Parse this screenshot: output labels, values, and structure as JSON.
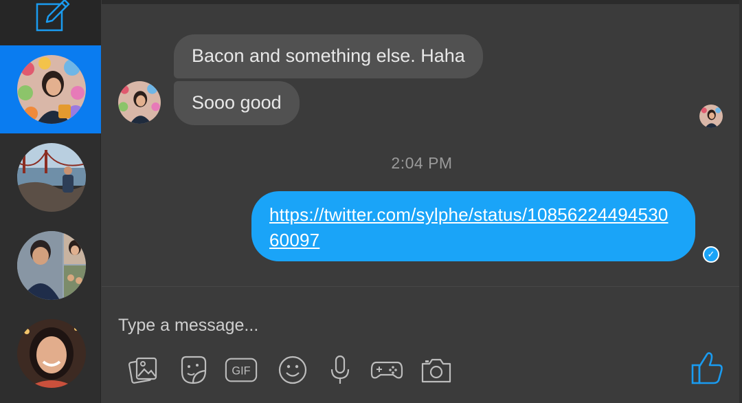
{
  "sidebar": {
    "compose_icon": "compose-icon",
    "conversations": [
      {
        "id": "conv-1",
        "active": true,
        "avatar": "avatar-woman-colorful-wall"
      },
      {
        "id": "conv-2",
        "active": false,
        "avatar": "avatar-golden-gate"
      },
      {
        "id": "conv-3",
        "active": false,
        "avatar": "avatar-group-collage"
      },
      {
        "id": "conv-4",
        "active": false,
        "avatar": "avatar-smiling-woman"
      }
    ]
  },
  "chat": {
    "messages_in": [
      {
        "text": "Bacon and something else. Haha"
      },
      {
        "text": "Sooo good"
      }
    ],
    "timestamp": "2:04 PM",
    "message_out": {
      "text": "https://twitter.com/sylphe/status/1085622449453060097",
      "status_icon": "check-icon"
    }
  },
  "composer": {
    "placeholder": "Type a message...",
    "tools": [
      "image-icon",
      "sticker-icon",
      "gif-icon",
      "emoji-icon",
      "microphone-icon",
      "game-controller-icon",
      "camera-icon"
    ],
    "gif_label": "GIF",
    "like_icon": "thumbs-up-icon"
  },
  "colors": {
    "accent": "#0a7cf0",
    "outgoing_bubble": "#1aa4f8",
    "incoming_bubble": "#515151",
    "background": "#3b3b3b"
  }
}
